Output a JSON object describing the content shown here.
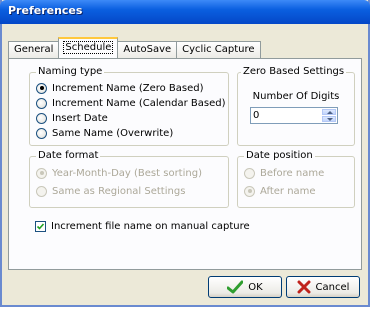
{
  "window": {
    "title": "Preferences"
  },
  "tabs": [
    {
      "label": "General",
      "active": false
    },
    {
      "label": "Schedule",
      "active": true
    },
    {
      "label": "AutoSave",
      "active": false
    },
    {
      "label": "Cyclic Capture",
      "active": false
    }
  ],
  "naming_type": {
    "legend": "Naming type",
    "options": [
      {
        "label": "Increment Name (Zero Based)",
        "checked": true
      },
      {
        "label": "Increment Name (Calendar Based)",
        "checked": false
      },
      {
        "label": "Insert Date",
        "checked": false
      },
      {
        "label": "Same Name (Overwrite)",
        "checked": false
      }
    ]
  },
  "zero_based": {
    "legend": "Zero Based Settings",
    "digits_label": "Number Of Digits",
    "digits_value": "0"
  },
  "date_format": {
    "legend": "Date format",
    "options": [
      {
        "label": "Year-Month-Day (Best sorting)",
        "checked": true,
        "enabled": false
      },
      {
        "label": "Same as Regional Settings",
        "checked": false,
        "enabled": false
      }
    ]
  },
  "date_position": {
    "legend": "Date position",
    "options": [
      {
        "label": "Before name",
        "checked": false,
        "enabled": false
      },
      {
        "label": "After name",
        "checked": true,
        "enabled": false
      }
    ]
  },
  "increment_manual": {
    "label": "Increment file name on manual capture",
    "checked": true
  },
  "buttons": {
    "ok_label": "OK",
    "cancel_label": "Cancel"
  },
  "colors": {
    "title_bar": "#0a5fe0",
    "dialog_bg": "#ece9d8",
    "tab_highlight": "#ffc83c",
    "ok_check": "#2f9e2f",
    "cancel_x": "#c0231c"
  }
}
